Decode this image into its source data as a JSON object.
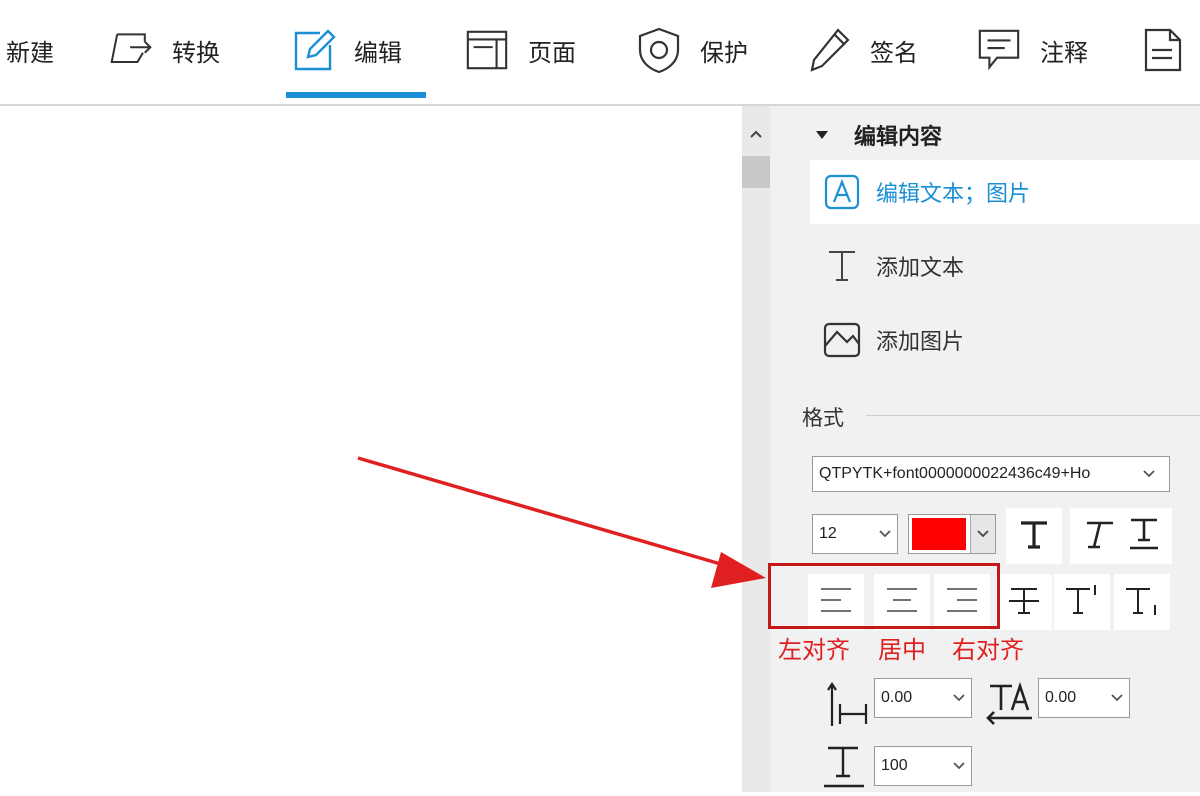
{
  "toolbar": {
    "items": [
      {
        "label": "新建",
        "icon": "new-icon"
      },
      {
        "label": "转换",
        "icon": "convert-icon"
      },
      {
        "label": "编辑",
        "icon": "edit-pencil-icon",
        "active": true
      },
      {
        "label": "页面",
        "icon": "page-icon"
      },
      {
        "label": "保护",
        "icon": "shield-icon"
      },
      {
        "label": "签名",
        "icon": "pen-icon"
      },
      {
        "label": "注释",
        "icon": "comment-icon"
      },
      {
        "label": "",
        "icon": "document-icon"
      }
    ],
    "active_color": "#1a8fd6"
  },
  "panel": {
    "section_title": "编辑内容",
    "actions": [
      {
        "label": "编辑文本；图片",
        "icon": "edit-text-a-icon",
        "selected": true
      },
      {
        "label": "添加文本",
        "icon": "add-text-t-icon"
      },
      {
        "label": "添加图片",
        "icon": "add-image-icon"
      }
    ],
    "format_title": "格式",
    "font_name": "QTPYTK+font0000000022436c49+Ho",
    "font_size": "12",
    "font_color": "#ff0000",
    "style_buttons": [
      "bold-t-icon",
      "italic-t-icon",
      "underline-t-icon"
    ],
    "align_buttons": [
      "align-left-icon",
      "align-center-icon",
      "align-right-icon"
    ],
    "extra_buttons": [
      "strikethrough-icon",
      "superscript-icon",
      "subscript-icon"
    ],
    "line_spacing": "0.00",
    "char_spacing": "0.00",
    "scale": "100"
  },
  "annotation": {
    "labels": [
      "左对齐",
      "居中",
      "右对齐"
    ],
    "color": "#e02020"
  }
}
